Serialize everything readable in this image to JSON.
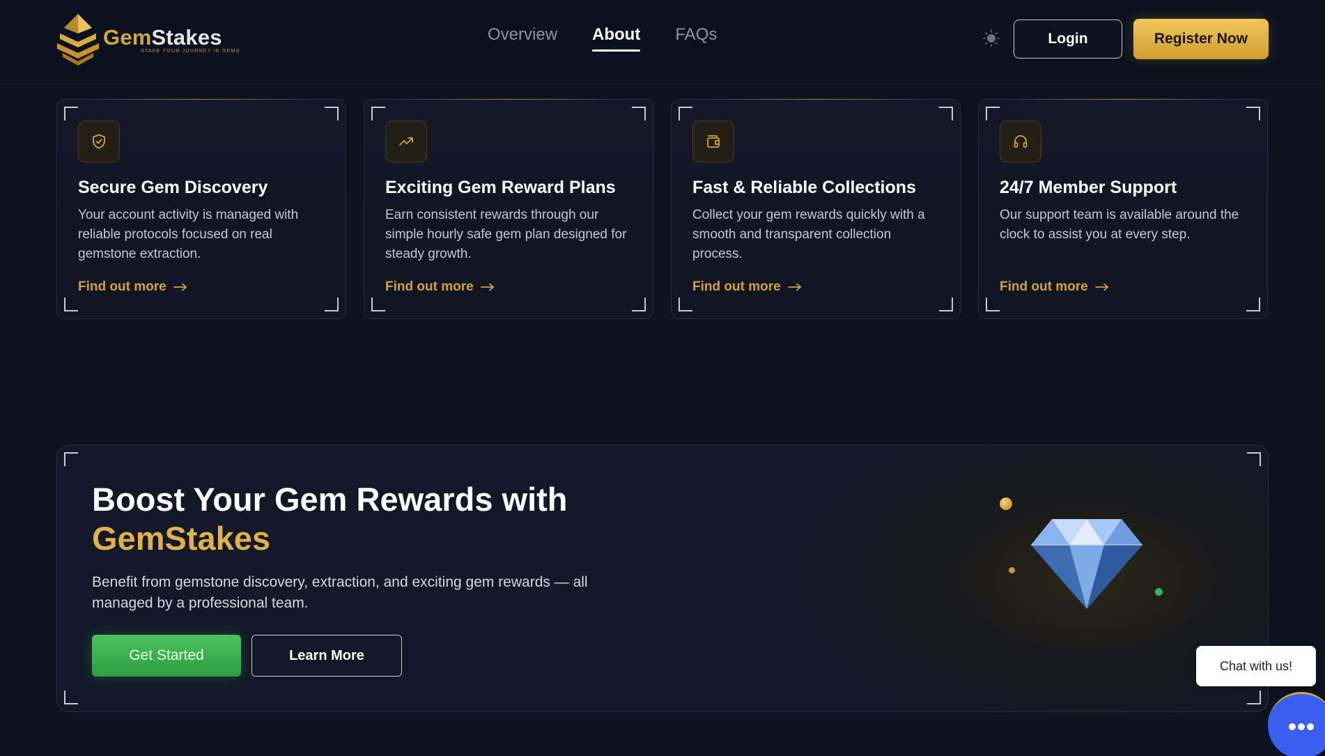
{
  "header": {
    "brand_name_part1": "Gem",
    "brand_name_part2": "Stakes",
    "brand_tagline": "STAKE YOUR JOURNEY IN GEMS",
    "nav": [
      {
        "label": "Overview",
        "active": false
      },
      {
        "label": "About",
        "active": true
      },
      {
        "label": "FAQs",
        "active": false
      }
    ],
    "login_label": "Login",
    "register_label": "Register Now"
  },
  "features": [
    {
      "icon": "shield-icon",
      "title": "Secure Gem Discovery",
      "description": "Your account activity is managed with reliable protocols focused on real gemstone extraction.",
      "link": "Find out more"
    },
    {
      "icon": "trending-up-icon",
      "title": "Exciting Gem Reward Plans",
      "description": "Earn consistent rewards through our simple hourly safe gem plan designed for steady growth.",
      "link": "Find out more"
    },
    {
      "icon": "wallet-icon",
      "title": "Fast & Reliable Collections",
      "description": "Collect your gem rewards quickly with a smooth and transparent collection process.",
      "link": "Find out more"
    },
    {
      "icon": "headphones-icon",
      "title": "24/7 Member Support",
      "description": "Our support team is available around the clock to assist you at every step.",
      "link": "Find out more"
    }
  ],
  "cta": {
    "title_line1": "Boost Your Gem Rewards with",
    "title_line2": "GemStakes",
    "description": "Benefit from gemstone discovery, extraction, and exciting gem rewards — all managed by a professional team.",
    "primary_label": "Get Started",
    "secondary_label": "Learn More"
  },
  "chat": {
    "bubble_text": "Chat with us!"
  },
  "colors": {
    "background": "#0c1220",
    "accent_gold": "#d4a23a",
    "accent_green": "#3fb152",
    "chat_blue": "#3a5ff0"
  }
}
